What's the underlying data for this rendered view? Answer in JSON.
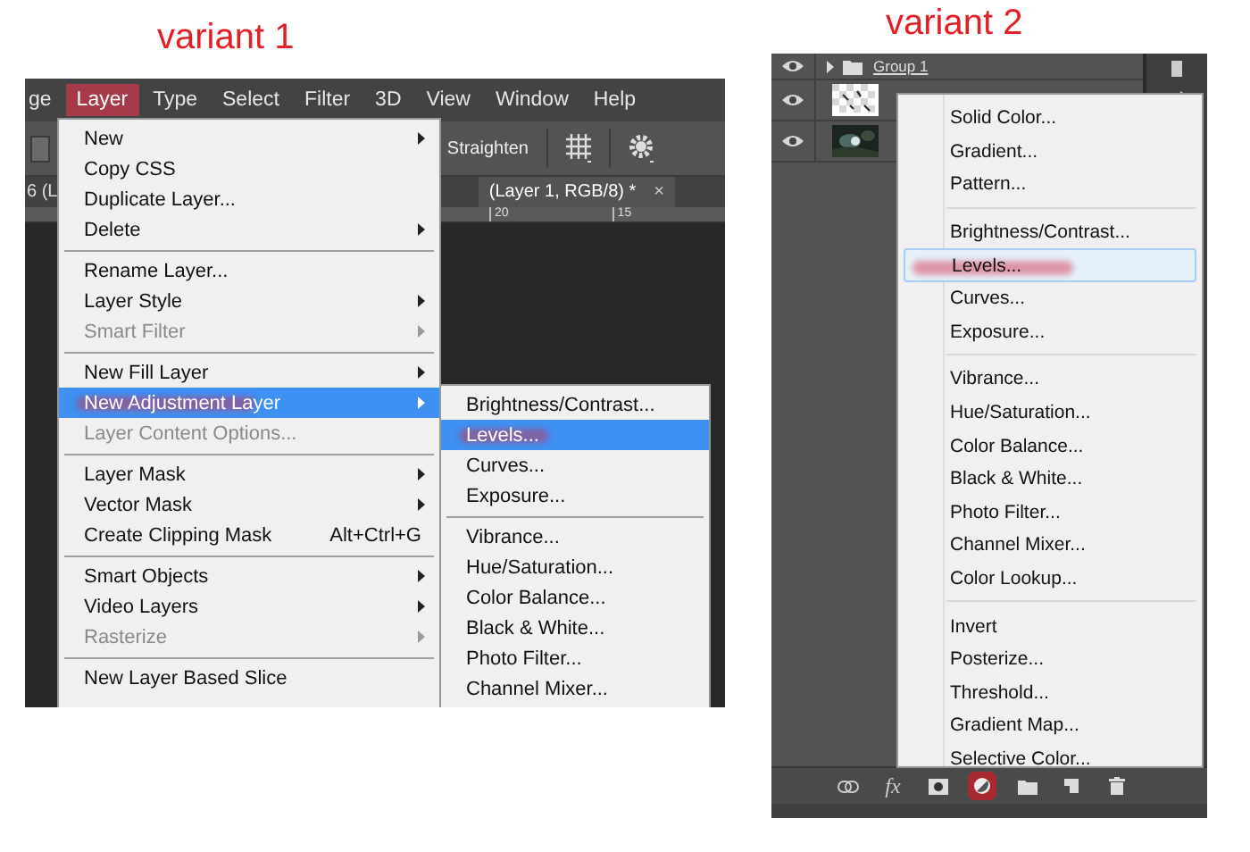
{
  "variant_1": {
    "label": "variant 1",
    "menu_bar": [
      {
        "label": "ge",
        "selected": false
      },
      {
        "label": "Layer",
        "selected": true
      },
      {
        "label": "Type",
        "selected": false
      },
      {
        "label": "Select",
        "selected": false
      },
      {
        "label": "Filter",
        "selected": false
      },
      {
        "label": "3D",
        "selected": false
      },
      {
        "label": "View",
        "selected": false
      },
      {
        "label": "Window",
        "selected": false
      },
      {
        "label": "Help",
        "selected": false
      }
    ],
    "options_bar": {
      "straighten": "Straighten"
    },
    "document_tabs": [
      {
        "label": "6 (L",
        "active": false
      },
      {
        "label": "(Layer 1, RGB/8) *",
        "active": true,
        "close": "×"
      }
    ],
    "ruler": [
      "20",
      "15"
    ],
    "layer_menu": {
      "groups": [
        [
          {
            "label": "New",
            "submenu": true,
            "disabled": false,
            "selected": false
          },
          {
            "label": "Copy CSS",
            "submenu": false,
            "disabled": false,
            "selected": false
          },
          {
            "label": "Duplicate Layer...",
            "submenu": false,
            "disabled": false,
            "selected": false
          },
          {
            "label": "Delete",
            "submenu": true,
            "disabled": false,
            "selected": false
          }
        ],
        [
          {
            "label": "Rename Layer...",
            "submenu": false,
            "disabled": false,
            "selected": false
          },
          {
            "label": "Layer Style",
            "submenu": true,
            "disabled": false,
            "selected": false
          },
          {
            "label": "Smart Filter",
            "submenu": true,
            "disabled": true,
            "selected": false
          }
        ],
        [
          {
            "label": "New Fill Layer",
            "submenu": true,
            "disabled": false,
            "selected": false
          },
          {
            "label": "New Adjustment Layer",
            "submenu": true,
            "disabled": false,
            "selected": true
          },
          {
            "label": "Layer Content Options...",
            "submenu": false,
            "disabled": true,
            "selected": false
          }
        ],
        [
          {
            "label": "Layer Mask",
            "submenu": true,
            "disabled": false,
            "selected": false
          },
          {
            "label": "Vector Mask",
            "submenu": true,
            "disabled": false,
            "selected": false
          },
          {
            "label": "Create Clipping Mask",
            "shortcut": "Alt+Ctrl+G",
            "submenu": false,
            "disabled": false,
            "selected": false
          }
        ],
        [
          {
            "label": "Smart Objects",
            "submenu": true,
            "disabled": false,
            "selected": false
          },
          {
            "label": "Video Layers",
            "submenu": true,
            "disabled": false,
            "selected": false
          },
          {
            "label": "Rasterize",
            "submenu": true,
            "disabled": true,
            "selected": false
          }
        ],
        [
          {
            "label": "New Layer Based Slice",
            "submenu": false,
            "disabled": false,
            "selected": false
          }
        ]
      ]
    },
    "adjustment_submenu": {
      "groups": [
        [
          {
            "label": "Brightness/Contrast...",
            "selected": false
          },
          {
            "label": "Levels...",
            "selected": true
          },
          {
            "label": "Curves...",
            "selected": false
          },
          {
            "label": "Exposure...",
            "selected": false
          }
        ],
        [
          {
            "label": "Vibrance...",
            "selected": false
          },
          {
            "label": "Hue/Saturation...",
            "selected": false
          },
          {
            "label": "Color Balance...",
            "selected": false
          },
          {
            "label": "Black & White...",
            "selected": false
          },
          {
            "label": "Photo Filter...",
            "selected": false
          },
          {
            "label": "Channel Mixer...",
            "selected": false
          }
        ]
      ]
    }
  },
  "variant_2": {
    "label": "variant 2",
    "layers": [
      {
        "kind": "group",
        "name": "Group 1",
        "visible": true
      },
      {
        "kind": "layer",
        "visible": true
      },
      {
        "kind": "layer",
        "visible": true
      }
    ],
    "adjustment_menu": {
      "groups": [
        [
          {
            "label": "Solid Color...",
            "selected": false
          },
          {
            "label": "Gradient...",
            "selected": false
          },
          {
            "label": "Pattern...",
            "selected": false
          }
        ],
        [
          {
            "label": "Brightness/Contrast...",
            "selected": false
          },
          {
            "label": "Levels...",
            "selected": true
          },
          {
            "label": "Curves...",
            "selected": false
          },
          {
            "label": "Exposure...",
            "selected": false
          }
        ],
        [
          {
            "label": "Vibrance...",
            "selected": false
          },
          {
            "label": "Hue/Saturation...",
            "selected": false
          },
          {
            "label": "Color Balance...",
            "selected": false
          },
          {
            "label": "Black & White...",
            "selected": false
          },
          {
            "label": "Photo Filter...",
            "selected": false
          },
          {
            "label": "Channel Mixer...",
            "selected": false
          },
          {
            "label": "Color Lookup...",
            "selected": false
          }
        ],
        [
          {
            "label": "Invert",
            "selected": false
          },
          {
            "label": "Posterize...",
            "selected": false
          },
          {
            "label": "Threshold...",
            "selected": false
          },
          {
            "label": "Gradient Map...",
            "selected": false
          },
          {
            "label": "Selective Color...",
            "selected": false
          }
        ]
      ]
    },
    "footer_buttons": [
      {
        "kind": "link",
        "marked": false
      },
      {
        "kind": "fx",
        "label": "fx",
        "marked": false
      },
      {
        "kind": "mask",
        "marked": false
      },
      {
        "kind": "adjustment",
        "marked": true
      },
      {
        "kind": "folder",
        "marked": false
      },
      {
        "kind": "new",
        "marked": false
      },
      {
        "kind": "trash",
        "marked": false
      }
    ]
  }
}
